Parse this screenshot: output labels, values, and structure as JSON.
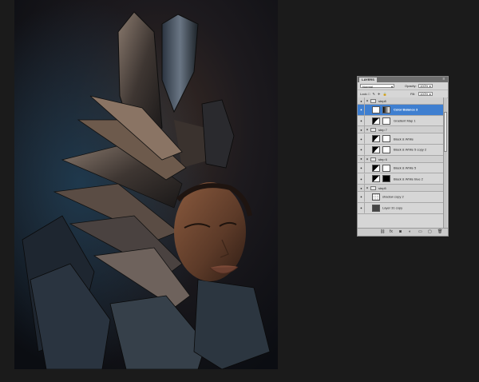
{
  "artwork": {
    "description_icon": "portrait-artwork"
  },
  "layers_panel": {
    "tab_label": "LAYERS",
    "menu_icon": "panel-menu-icon",
    "blend_mode": "Normal",
    "opacity_label": "Opacity:",
    "opacity_value": "100%",
    "lock_label": "Lock:",
    "fill_label": "Fill:",
    "fill_value": "100%",
    "rows": [
      {
        "type": "group",
        "name": "step8"
      },
      {
        "type": "layer",
        "name": "Color Balance 3",
        "selected": true
      },
      {
        "type": "layer",
        "name": "Gradient Map 1"
      },
      {
        "type": "group",
        "name": "step 7"
      },
      {
        "type": "layer",
        "name": "Black & White"
      },
      {
        "type": "layer",
        "name": "Black & White 5 copy 2"
      },
      {
        "type": "group",
        "name": "step 6"
      },
      {
        "type": "layer",
        "name": "Black & White 5"
      },
      {
        "type": "layer",
        "name": "Black & White blue 2"
      },
      {
        "type": "group",
        "name": "step5"
      },
      {
        "type": "layer",
        "name": "shadow copy 2"
      },
      {
        "type": "layer",
        "name": "Layer 31 copy"
      }
    ],
    "bottom_icons": [
      "link-icon",
      "fx-icon",
      "mask-icon",
      "adjustment-icon",
      "folder-icon",
      "new-layer-icon",
      "trash-icon"
    ]
  }
}
